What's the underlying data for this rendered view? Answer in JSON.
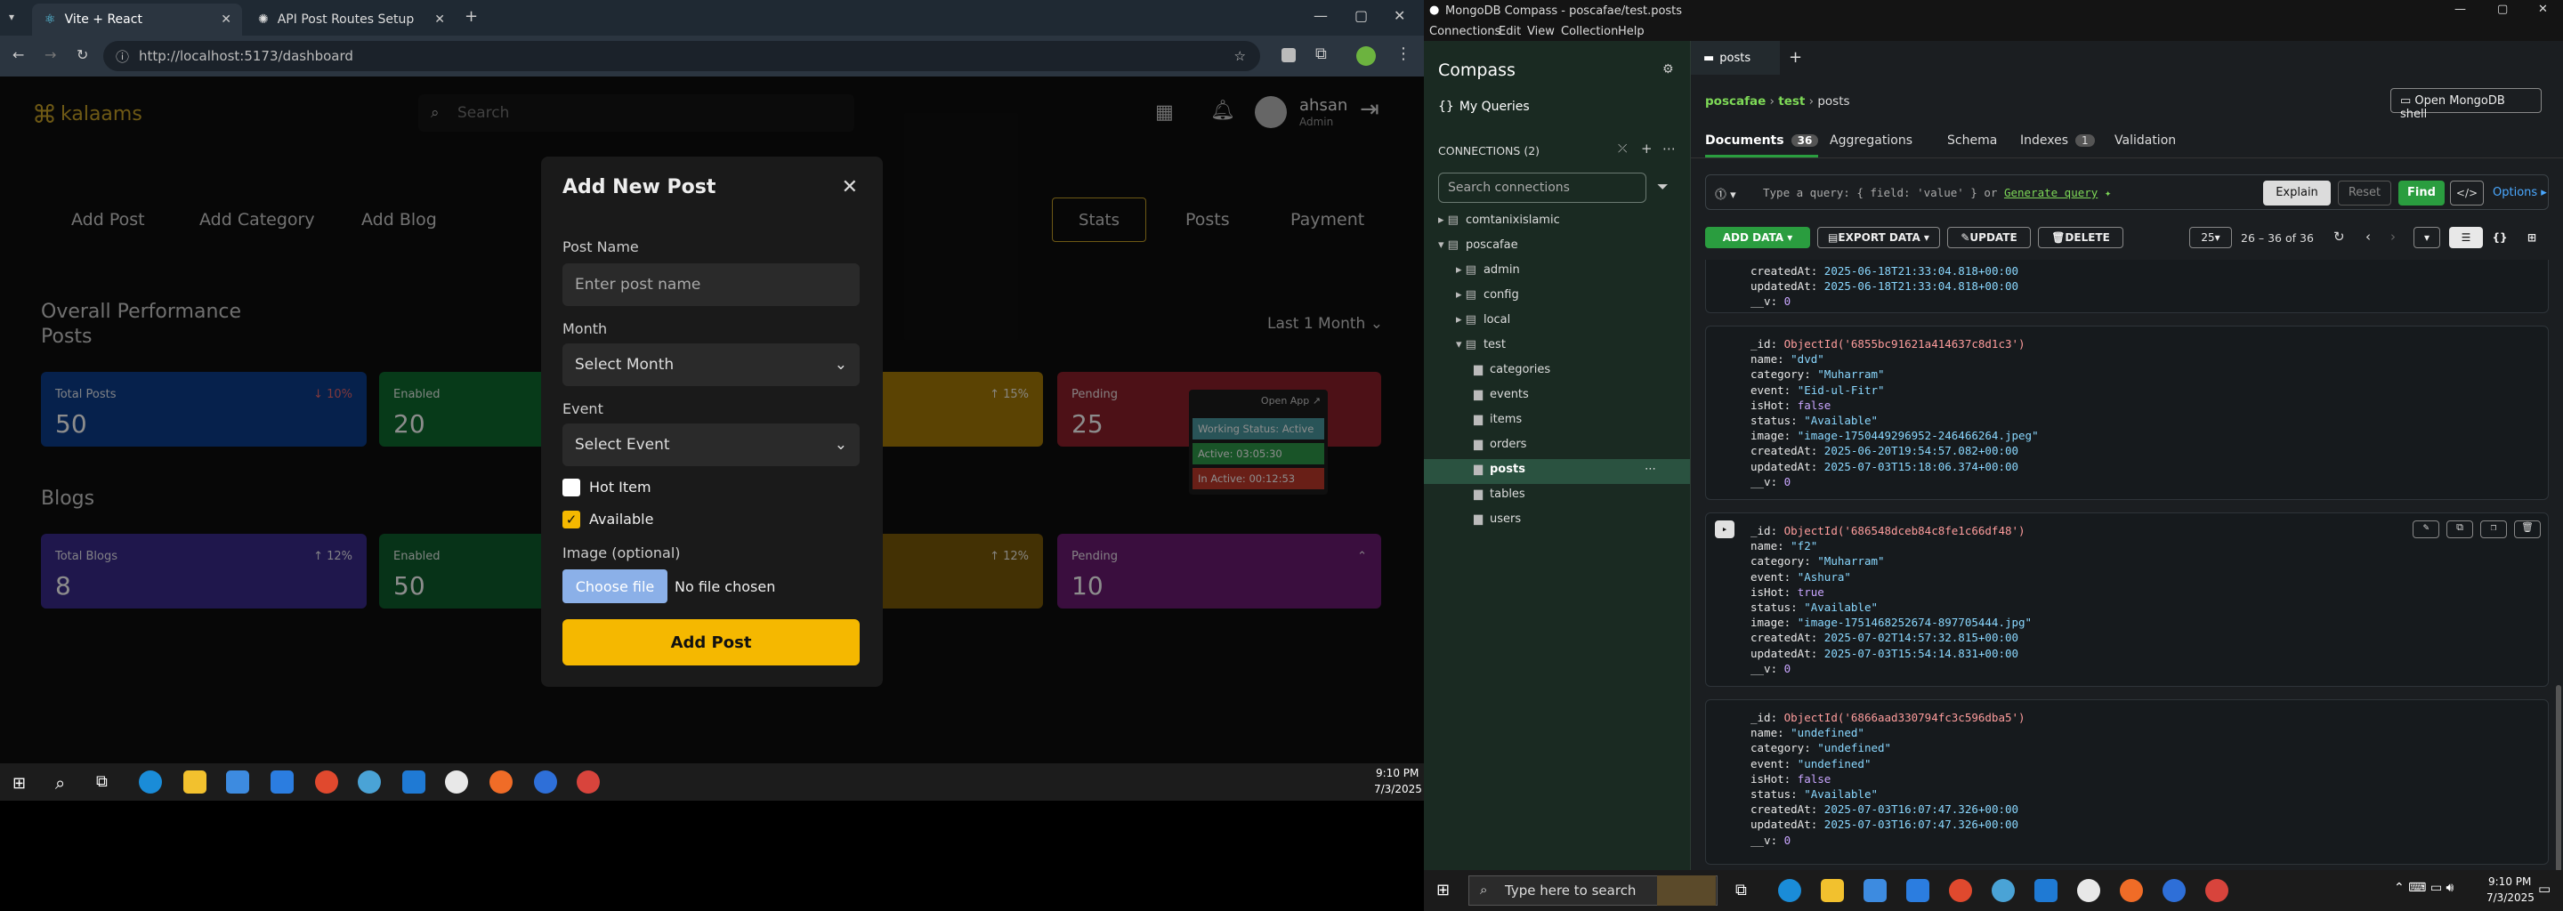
{
  "browser": {
    "tabs": [
      {
        "label": "Vite + React"
      },
      {
        "label": "API Post Routes Setup"
      }
    ],
    "url": "http://localhost:5173/dashboard"
  },
  "app": {
    "logo": "kalaams",
    "search_placeholder": "Search",
    "user": {
      "name": "ahsan",
      "role": "Admin"
    },
    "actions": [
      "Add Post",
      "Add Category",
      "Add Blog"
    ],
    "views": [
      "Stats",
      "Posts",
      "Payment"
    ],
    "section_title": "Overall Performance",
    "posts_title": "Posts",
    "period": "Last 1 Month",
    "posts_cards": [
      {
        "label": "Total Posts",
        "value": "50",
        "pct": "↓ 10%",
        "color": "#0b3c8a"
      },
      {
        "label": "Enabled",
        "value": "20",
        "pct": "",
        "color": "#0d6b2f"
      },
      {
        "label": "",
        "value": "",
        "pct": "↑ 15%",
        "color": "#a77b07"
      },
      {
        "label": "Pending",
        "value": "25",
        "pct": "",
        "color": "#8c1f2a"
      }
    ],
    "blogs_title": "Blogs",
    "blogs_cards": [
      {
        "label": "Total Blogs",
        "value": "8",
        "pct": "↑ 12%",
        "color": "#3a2a8a"
      },
      {
        "label": "Enabled",
        "value": "50",
        "pct": "",
        "color": "#0d5e2c"
      },
      {
        "label": "",
        "value": "",
        "pct": "↑ 12%",
        "color": "#7a5a08"
      },
      {
        "label": "Pending",
        "value": "10",
        "pct": "⌃",
        "color": "#6a1a72"
      }
    ],
    "popup": {
      "open": "Open App ↗",
      "working": "Working Status: Active",
      "active": "Active: 03:05:30",
      "inactive": "In Active: 00:12:53"
    }
  },
  "modal": {
    "title": "Add New Post",
    "close": "✕",
    "post_name_label": "Post Name",
    "post_name_placeholder": "Enter post name",
    "month_label": "Month",
    "month_value": "Select Month",
    "event_label": "Event",
    "event_value": "Select Event",
    "hot_label": "Hot Item",
    "available_label": "Available",
    "image_label": "Image (optional)",
    "choose_file": "Choose file",
    "no_file": "No file chosen",
    "submit": "Add Post"
  },
  "taskbar_left": {
    "time": "9:10 PM",
    "date": "7/3/2025"
  },
  "compass": {
    "window_title": "MongoDB Compass - poscafae/test.posts",
    "menu": [
      "Connections",
      "Edit",
      "View",
      "Collection",
      "Help"
    ],
    "brand": "Compass",
    "my_queries": "My Queries",
    "connections_label": "CONNECTIONS (2)",
    "search_connections": "Search connections",
    "tree": [
      {
        "label": "comtanixislamic",
        "indent": 0
      },
      {
        "label": "poscafae",
        "indent": 0
      },
      {
        "label": "admin",
        "indent": 1
      },
      {
        "label": "config",
        "indent": 1
      },
      {
        "label": "local",
        "indent": 1
      },
      {
        "label": "test",
        "indent": 1
      },
      {
        "label": "categories",
        "indent": 2
      },
      {
        "label": "events",
        "indent": 2
      },
      {
        "label": "items",
        "indent": 2
      },
      {
        "label": "orders",
        "indent": 2
      },
      {
        "label": "posts",
        "indent": 2
      },
      {
        "label": "tables",
        "indent": 2
      },
      {
        "label": "users",
        "indent": 2
      }
    ],
    "tab": "posts",
    "breadcrumb": [
      "poscafae",
      "test",
      "posts"
    ],
    "open_shell": "Open MongoDB shell",
    "subtabs": [
      {
        "label": "Documents",
        "badge": "36"
      },
      {
        "label": "Aggregations",
        "badge": ""
      },
      {
        "label": "Schema",
        "badge": ""
      },
      {
        "label": "Indexes",
        "badge": "1"
      },
      {
        "label": "Validation",
        "badge": ""
      }
    ],
    "query_placeholder": "Type a query: { field: 'value' } or",
    "generate_query": "Generate query",
    "explain": "Explain",
    "reset": "Reset",
    "find": "Find",
    "options": "Options ▸",
    "add_data": "ADD DATA ▾",
    "export_data": "EXPORT DATA ▾",
    "update": "UPDATE",
    "delete": "DELETE",
    "page_size": "25",
    "range": "26 – 36 of 36",
    "doc0": [
      [
        "createdAt: ",
        "2025-06-18T21:33:04.818+00:00",
        "s"
      ],
      [
        "updatedAt: ",
        "2025-06-18T21:33:04.818+00:00",
        "s"
      ],
      [
        "__v: ",
        "0",
        "n"
      ]
    ],
    "docs": [
      [
        [
          "_id: ",
          "ObjectId('6855bc91621a414637c8d1c3')",
          "id"
        ],
        [
          "name: ",
          "\"dvd\"",
          "s"
        ],
        [
          "category: ",
          "\"Muharram\"",
          "s"
        ],
        [
          "event: ",
          "\"Eid-ul-Fitr\"",
          "s"
        ],
        [
          "isHot: ",
          "false",
          "n"
        ],
        [
          "status: ",
          "\"Available\"",
          "s"
        ],
        [
          "image: ",
          "\"image-1750449296952-246466264.jpeg\"",
          "s"
        ],
        [
          "createdAt: ",
          "2025-06-20T19:54:57.082+00:00",
          "s"
        ],
        [
          "updatedAt: ",
          "2025-07-03T15:18:06.374+00:00",
          "s"
        ],
        [
          "__v: ",
          "0",
          "n"
        ]
      ],
      [
        [
          "_id: ",
          "ObjectId('686548dceb84c8fe1c66df48')",
          "id"
        ],
        [
          "name: ",
          "\"f2\"",
          "s"
        ],
        [
          "category: ",
          "\"Muharram\"",
          "s"
        ],
        [
          "event: ",
          "\"Ashura\"",
          "s"
        ],
        [
          "isHot: ",
          "true",
          "n"
        ],
        [
          "status: ",
          "\"Available\"",
          "s"
        ],
        [
          "image: ",
          "\"image-1751468252674-897705444.jpg\"",
          "s"
        ],
        [
          "createdAt: ",
          "2025-07-02T14:57:32.815+00:00",
          "s"
        ],
        [
          "updatedAt: ",
          "2025-07-03T15:54:14.831+00:00",
          "s"
        ],
        [
          "__v: ",
          "0",
          "n"
        ]
      ],
      [
        [
          "_id: ",
          "ObjectId('6866aad330794fc3c596dba5')",
          "id"
        ],
        [
          "name: ",
          "\"undefined\"",
          "s"
        ],
        [
          "category: ",
          "\"undefined\"",
          "s"
        ],
        [
          "event: ",
          "\"undefined\"",
          "s"
        ],
        [
          "isHot: ",
          "false",
          "n"
        ],
        [
          "status: ",
          "\"Available\"",
          "s"
        ],
        [
          "createdAt: ",
          "2025-07-03T16:07:47.326+00:00",
          "s"
        ],
        [
          "updatedAt: ",
          "2025-07-03T16:07:47.326+00:00",
          "s"
        ],
        [
          "__v: ",
          "0",
          "n"
        ]
      ]
    ]
  },
  "taskbar_right": {
    "search_placeholder": "Type here to search",
    "time": "9:10 PM",
    "date": "7/3/2025"
  }
}
